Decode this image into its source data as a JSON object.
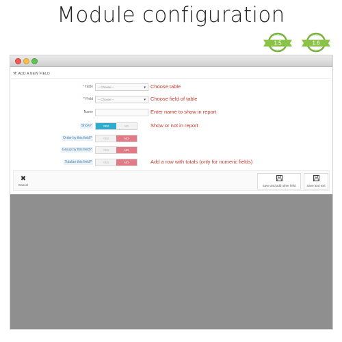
{
  "page_title": "Module configuration",
  "badges": [
    "1.5",
    "1.6"
  ],
  "badge_text": "PRESTASHOP",
  "badge_ribbon": "READY",
  "panel": {
    "heading": "ADD A NEW FIELD",
    "heading_icon": "tool-icon"
  },
  "fields": {
    "table": {
      "label": "Table",
      "select_value": "-- Choose --",
      "annotation": "Choose table"
    },
    "field": {
      "label": "Field",
      "select_value": "-- Choose --",
      "annotation": "Choose field of table"
    },
    "name": {
      "label": "Name",
      "value": "",
      "annotation": "Enter name to show in report"
    },
    "show": {
      "label": "Show?",
      "yes": "YES",
      "no": "NO",
      "selected": "YES",
      "annotation": "Show or not in report"
    },
    "order": {
      "label": "Order by this field?",
      "yes": "YES",
      "no": "NO",
      "selected": "NO"
    },
    "group": {
      "label": "Group by this field?",
      "yes": "YES",
      "no": "NO",
      "selected": "NO"
    },
    "totalize": {
      "label": "Totalize this field?",
      "yes": "YES",
      "no": "NO",
      "selected": "NO",
      "annotation": "Add a row with totals (only for numeric fields)"
    }
  },
  "footer": {
    "cancel": "Cancel",
    "save_add": "Save and add other field",
    "save_exit": "Save and exit"
  },
  "colors": {
    "toggle_yes": "#2eacce",
    "toggle_no": "#e07b85",
    "annotation": "#c0392b",
    "badge_green": "#7cb342"
  }
}
